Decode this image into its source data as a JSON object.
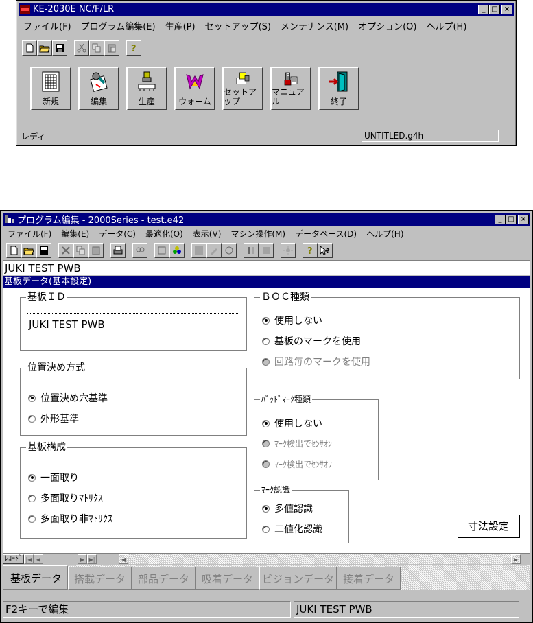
{
  "win1": {
    "title": "KE-2030E NC/F/LR",
    "menus": [
      "ファイル(F)",
      "プログラム編集(E)",
      "生産(P)",
      "セットアップ(S)",
      "メンテナンス(M)",
      "オプション(O)",
      "ヘルプ(H)"
    ],
    "toolbar_icons": [
      "new-icon",
      "open-icon",
      "save-icon",
      "cut-icon",
      "copy-icon",
      "paste-icon",
      "help-icon"
    ],
    "big_buttons": [
      {
        "label": "新規",
        "icon": "new-grid-icon"
      },
      {
        "label": "編集",
        "icon": "edit-icon"
      },
      {
        "label": "生産",
        "icon": "production-icon"
      },
      {
        "label": "ウォーム",
        "icon": "warm-icon"
      },
      {
        "label": "セットアップ",
        "icon": "setup-icon"
      },
      {
        "label": "マニュアル",
        "icon": "manual-icon"
      },
      {
        "label": "終了",
        "icon": "exit-icon"
      }
    ],
    "status_left": "レディ",
    "status_file": "UNTITLED.g4h"
  },
  "win2": {
    "title": "プログラム編集 - 2000Series - test.e42",
    "menus": [
      "ファイル(F)",
      "編集(E)",
      "データ(C)",
      "最適化(O)",
      "表示(V)",
      "マシン操作(M)",
      "データベース(D)",
      "ヘルプ(H)"
    ],
    "board_name": "JUKI TEST PWB",
    "panel_title": "基板データ(基本設定)",
    "board_id": {
      "label": "基板ＩＤ",
      "value": "JUKI TEST PWB"
    },
    "positioning": {
      "label": "位置決め方式",
      "options": [
        "位置決め穴基準",
        "外形基準"
      ],
      "selected": 0
    },
    "board_config": {
      "label": "基板構成",
      "options": [
        "一面取り",
        "多面取りﾏﾄﾘｸｽ",
        "多面取り非ﾏﾄﾘｸｽ"
      ],
      "selected": 0
    },
    "boc": {
      "label": "ＢＯＣ種類",
      "options": [
        "使用しない",
        "基板のマークを使用",
        "回路毎のマークを使用"
      ],
      "selected": 0
    },
    "bad_mark": {
      "label": "ﾊﾞｯﾄﾞﾏｰｸ種類",
      "options": [
        "使用しない",
        "ﾏｰｸ検出でｾﾝｻｵﾝ",
        "ﾏｰｸ検出でｾﾝｻｵﾌ"
      ],
      "selected": 0
    },
    "mark_recog": {
      "label": "ﾏｰｸ認識",
      "options": [
        "多値認識",
        "二値化認識"
      ],
      "selected": 0
    },
    "dimension_button": "寸法設定",
    "record_label": "ﾚｺｰﾄﾞ",
    "tabs": [
      "基板データ",
      "搭載データ",
      "部品データ",
      "吸着データ",
      "ビジョンデータ",
      "接着データ"
    ],
    "status_left": "F2キーで編集",
    "status_right": "JUKI TEST PWB"
  }
}
